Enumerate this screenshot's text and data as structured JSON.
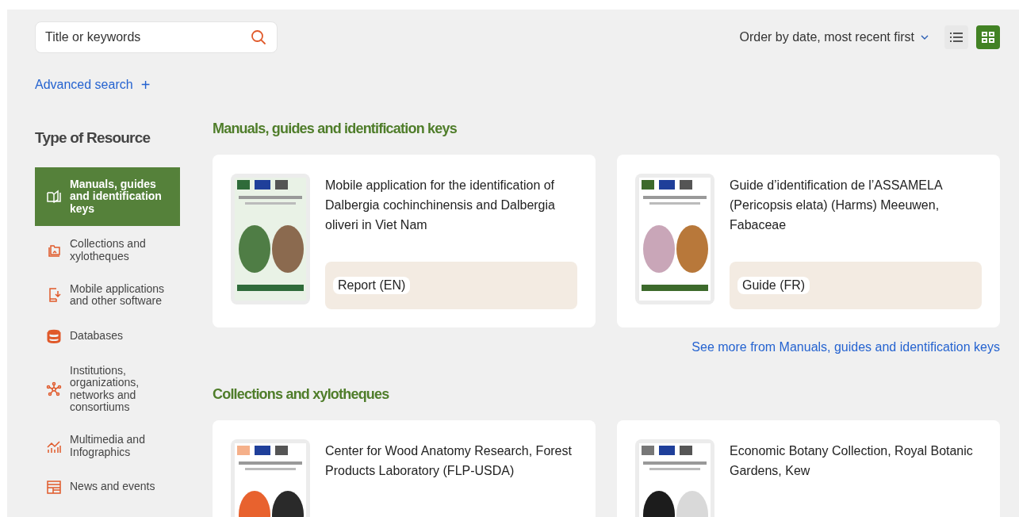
{
  "search": {
    "placeholder": "Title or keywords"
  },
  "sort": {
    "label": "Order by date, most recent first"
  },
  "view_toggle": [
    {
      "kind": "list",
      "selected": false
    },
    {
      "kind": "grid",
      "selected": true
    }
  ],
  "advanced_search": {
    "label": "Advanced search",
    "symbol": "+"
  },
  "sidebar": {
    "title": "Type of Resource",
    "items": [
      {
        "label": "Manuals, guides and identification keys",
        "selected": true
      },
      {
        "label": "Collections and xylotheques",
        "selected": false
      },
      {
        "label": "Mobile applications and other software",
        "selected": false
      },
      {
        "label": "Databases",
        "selected": false
      },
      {
        "label": "Institutions, organizations, networks and consortiums",
        "selected": false
      },
      {
        "label": "Multimedia and Infographics",
        "selected": false
      },
      {
        "label": "News and events",
        "selected": false
      }
    ]
  },
  "sections": [
    {
      "title": "Manuals, guides and identification keys",
      "cards": [
        {
          "title": "Mobile application for the identification of Dalbergia cochinchinensis and Dalbergia oliveri in Viet Nam",
          "tag": "Report (EN)"
        },
        {
          "title": "Guide d’identification de l’ASSAMELA (Pericopsis elata) (Harms) Meeuwen, Fabaceae",
          "tag": "Guide (FR)"
        }
      ],
      "see_more": "See more from Manuals, guides and identification keys"
    },
    {
      "title": "Collections and xylotheques",
      "cards": [
        {
          "title": "Center for Wood Anatomy Research, Forest Products Laboratory (FLP-USDA)"
        },
        {
          "title": "Economic Botany Collection, Royal Botanic Gardens, Kew"
        }
      ]
    }
  ]
}
